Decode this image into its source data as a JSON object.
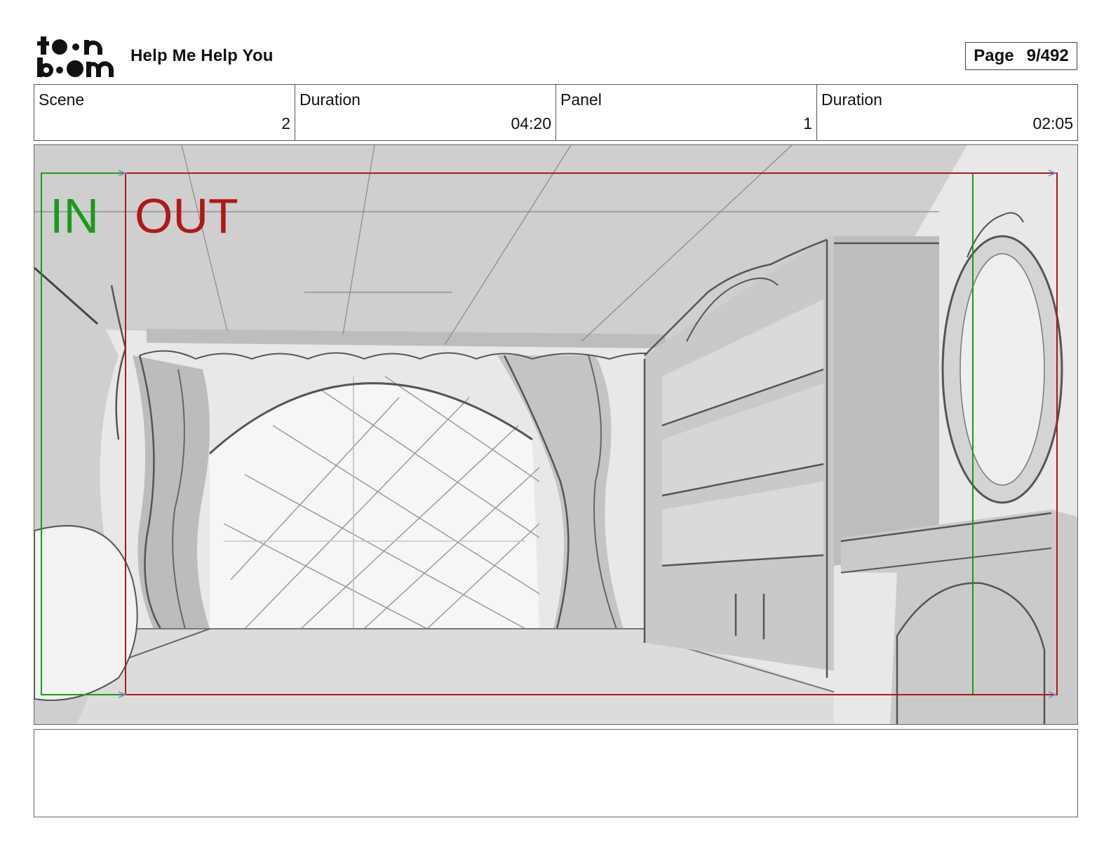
{
  "header": {
    "logo_text": "toon boom",
    "project_title": "Help Me Help You",
    "page_label": "Page",
    "page_value": "9/492"
  },
  "info": [
    {
      "label": "Scene",
      "value": "2"
    },
    {
      "label": "Duration",
      "value": "04:20"
    },
    {
      "label": "Panel",
      "value": "1"
    },
    {
      "label": "Duration",
      "value": "02:05"
    }
  ],
  "panel": {
    "in_label": "IN",
    "out_label": "OUT",
    "colors": {
      "in": "#1a9a1a",
      "out": "#b01818",
      "sketch_line": "#555555",
      "paper": "#e6e6e6"
    }
  },
  "notes": {
    "text": ""
  }
}
